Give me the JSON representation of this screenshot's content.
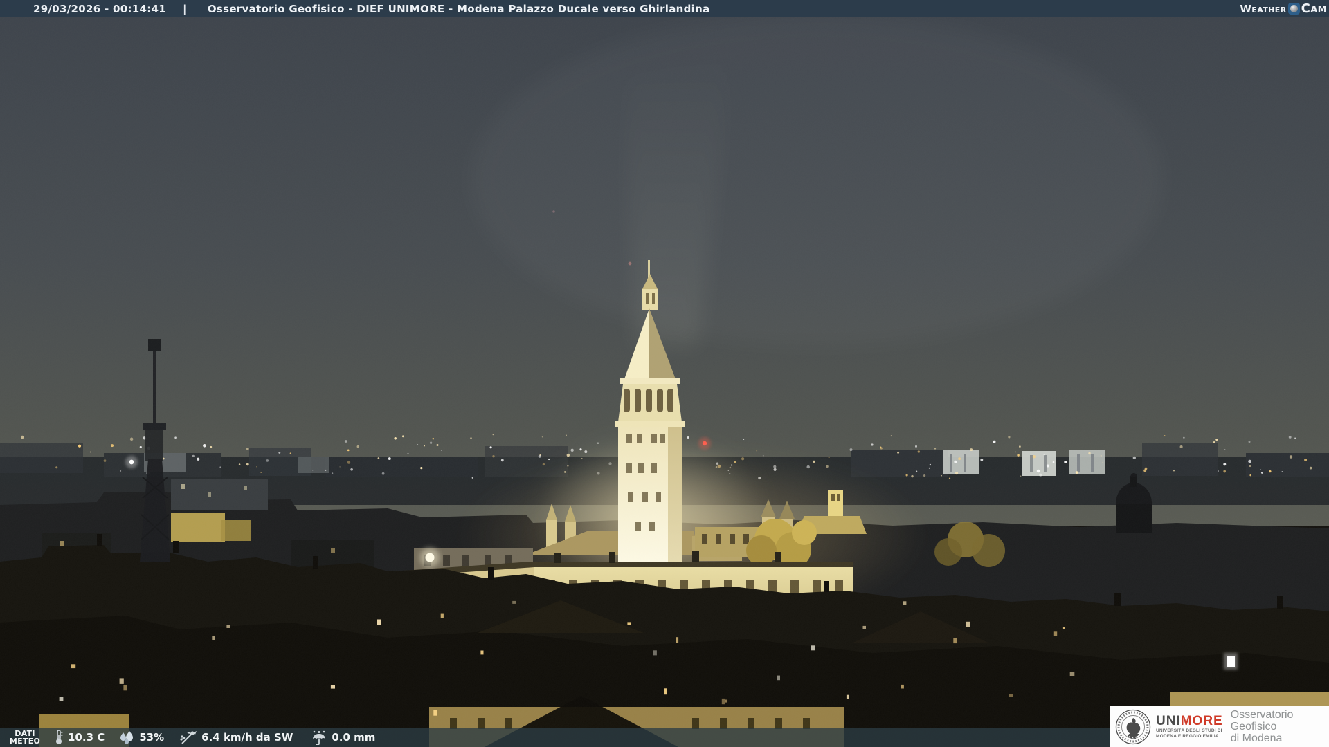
{
  "header": {
    "datetime": "29/03/2026 - 00:14:41",
    "separator": "|",
    "title": "Osservatorio Geofisico - DIEF UNIMORE - Modena Palazzo Ducale verso Ghirlandina",
    "brand": {
      "weather": "Weather",
      "cam": "Cam"
    }
  },
  "footer": {
    "badge_line1": "DATI",
    "badge_line2": "METEO",
    "temperature": "10.3 C",
    "humidity": "53%",
    "wind": "6.4 km/h da SW",
    "rain": "0.0 mm"
  },
  "branding": {
    "uni": "UNI",
    "more": "MORE",
    "university_line1": "UNIVERSITÀ DEGLI STUDI DI",
    "university_line2": "MODENA E REGGIO EMILIA",
    "observatory_line1": "Osservatorio Geofisico",
    "observatory_line2": "di Modena"
  },
  "icons": {
    "brand_sphere": "sphere-icon",
    "temperature": "thermometer-icon",
    "humidity": "humidity-icon",
    "wind": "wind-icon",
    "rain": "rain-icon",
    "seal": "unimore-seal-icon"
  },
  "colors": {
    "header_bar": "#2c3c4b",
    "footer_bar": "#2c3c44",
    "unimore_red": "#cf3a28",
    "overlay_text": "#f2f5f6",
    "sky_top": "#3d434b",
    "tower_light": "#f7eec6",
    "city_glow": "#ffd98e"
  }
}
